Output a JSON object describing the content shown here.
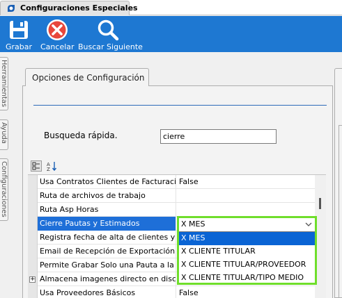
{
  "window": {
    "tab_title": "Configuraciones Especiales"
  },
  "toolbar": {
    "buttons": [
      {
        "label": "Grabar",
        "icon": "save-icon"
      },
      {
        "label": "Cancelar",
        "icon": "cancel-icon"
      },
      {
        "label": "Buscar Siguiente",
        "icon": "search-icon"
      }
    ]
  },
  "side_tabs": [
    "Herramientas",
    "Ayuda",
    "Configuraciones"
  ],
  "panel": {
    "tab_label": "Opciones de Configuración",
    "search_label": "Busqueda rápida.",
    "search_value": "cierre"
  },
  "grid": {
    "rows": [
      {
        "name": "Usa Contratos Clientes de Facturación",
        "value": "False"
      },
      {
        "name": "Ruta de archivos de trabajo",
        "value": ""
      },
      {
        "name": "Ruta Asp Horas",
        "value": ""
      },
      {
        "name": "Cierre Pautas y Estimados",
        "value": "X MES"
      },
      {
        "name": "Registra fecha de alta de clientes y proveedores",
        "value": ""
      },
      {
        "name": "Email de Recepción de Exportación",
        "value": ""
      },
      {
        "name": "Permite Grabar Solo una Pauta a la vez",
        "value": ""
      },
      {
        "name": "Almacena imagenes directo en disco",
        "value": ""
      },
      {
        "name": "Usa Proveedores Básicos",
        "value": "False"
      }
    ],
    "expander_symbol": "+"
  },
  "dropdown": {
    "current": "X MES",
    "options": [
      "X MES",
      "X CLIENTE TITULAR",
      "X CLIENTE TITULAR/PROVEEDOR",
      "X CLIENTE TITULAR/TIPO MEDIO"
    ],
    "selected_index": 0
  },
  "colors": {
    "toolbar_bg": "#1e78d2",
    "selection": "#1e6fd8",
    "dropdown_highlight": "#6fde2b"
  }
}
